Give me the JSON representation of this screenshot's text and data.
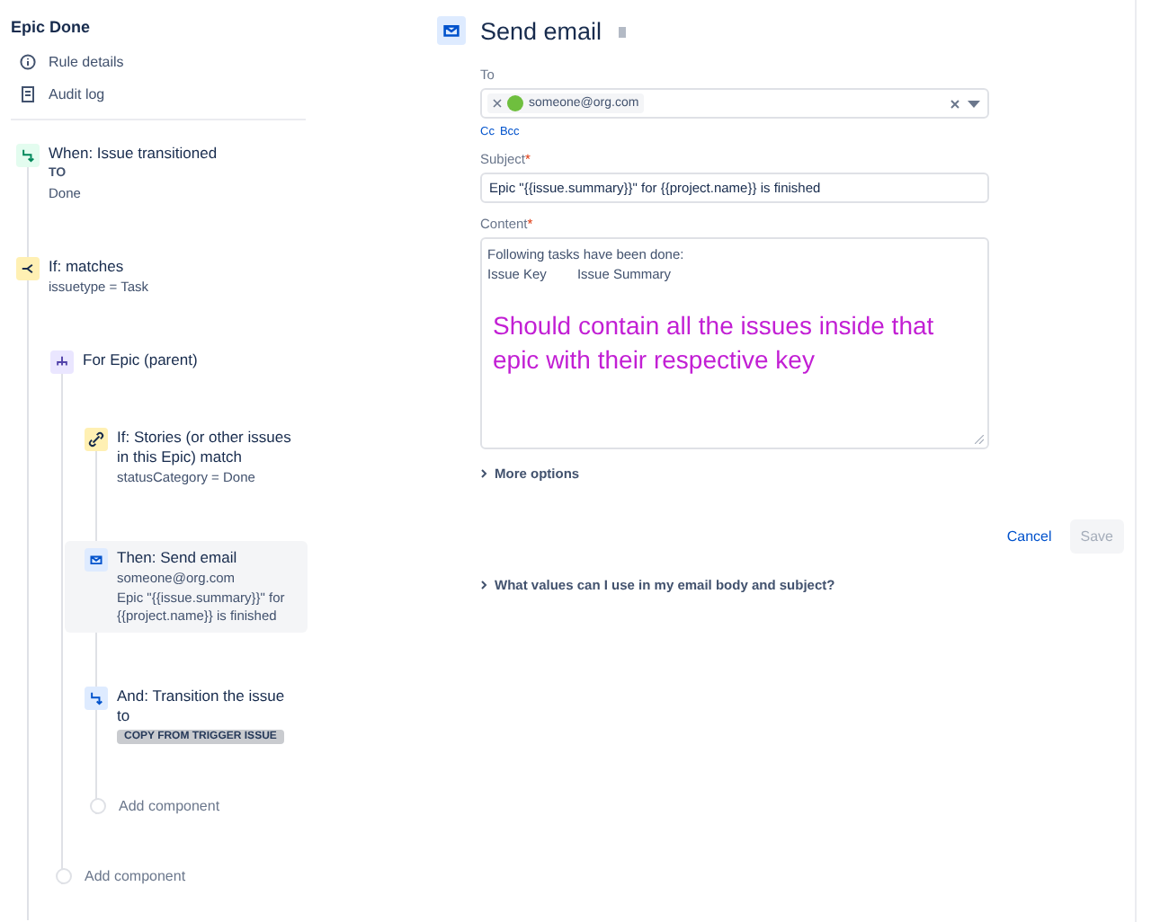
{
  "sidebar": {
    "title": "Epic Done",
    "links": [
      {
        "kind": "info",
        "label": "Rule details"
      },
      {
        "kind": "log",
        "label": "Audit log"
      }
    ]
  },
  "rule": {
    "components": [
      {
        "kind": "trigger",
        "title": "When: Issue transitioned",
        "field_label": "TO",
        "lines": [
          "Done"
        ],
        "selected": false
      },
      {
        "kind": "condition",
        "title": "If: matches",
        "lines": [
          "issuetype = Task"
        ],
        "selected": false,
        "children": [
          {
            "kind": "branch",
            "title": "For Epic (parent)",
            "selected": false,
            "children": [
              {
                "kind": "related",
                "title": "If: Stories (or other issues in this Epic) match",
                "lines": [
                  "statusCategory = Done"
                ],
                "selected": false
              },
              {
                "kind": "email",
                "title": "Then: Send email",
                "lines": [
                  "someone@org.com",
                  "Epic \"{{issue.summary}}\" for {{project.name}} is finished"
                ],
                "selected": true
              },
              {
                "kind": "transition",
                "title": "And: Transition the issue to",
                "tag": "COPY FROM TRIGGER ISSUE",
                "selected": false
              },
              {
                "kind": "add",
                "title": "Add component"
              }
            ]
          },
          {
            "kind": "add",
            "title": "Add component"
          }
        ]
      }
    ]
  },
  "editor": {
    "title": "Send email",
    "to": {
      "label": "To",
      "recipients": [
        "someone@org.com"
      ]
    },
    "cc_links": [
      "Cc",
      "Bcc"
    ],
    "subject": {
      "label": "Subject",
      "required_mark": "*",
      "value": "Epic \"{{issue.summary}}\" for {{project.name}} is finished"
    },
    "content": {
      "label": "Content",
      "required_mark": "*",
      "lines": [
        [
          "Following tasks have been done:"
        ],
        [
          "Issue Key",
          "Issue Summary"
        ]
      ],
      "annotation": "Should contain all the issues inside that epic with their respective key"
    },
    "more_options": "More options",
    "buttons": [
      {
        "kind": "link",
        "label": "Cancel",
        "disabled": false
      },
      {
        "kind": "primary",
        "label": "Save",
        "disabled": true
      }
    ],
    "help": "What values can I use in my email body and subject?"
  }
}
